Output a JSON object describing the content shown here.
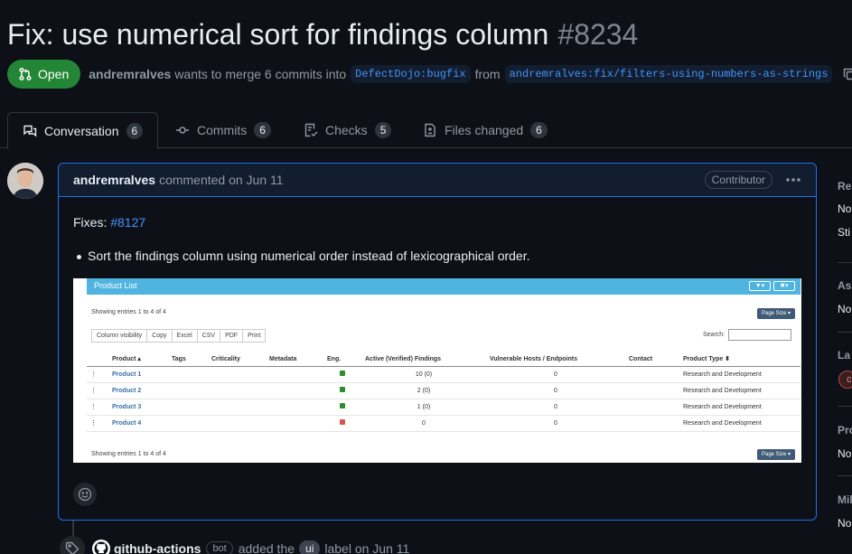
{
  "pr": {
    "title": "Fix: use numerical sort for findings column",
    "number": "#8234",
    "status": "Open",
    "author": "andremralves",
    "merge_text": "wants to merge 6 commits into",
    "base_branch": "DefectDojo:bugfix",
    "from_text": "from",
    "head_branch": "andremralves:fix/filters-using-numbers-as-strings"
  },
  "tabs": [
    {
      "label": "Conversation",
      "count": "6",
      "icon": "comment-discussion-icon"
    },
    {
      "label": "Commits",
      "count": "6",
      "icon": "git-commit-icon"
    },
    {
      "label": "Checks",
      "count": "5",
      "icon": "checklist-icon"
    },
    {
      "label": "Files changed",
      "count": "6",
      "icon": "file-diff-icon"
    }
  ],
  "comment": {
    "author": "andremralves",
    "meta": "commented on Jun 11",
    "role": "Contributor",
    "fixes_label": "Fixes:",
    "fixes_link": "#8127",
    "bullet": "Sort the findings column using numerical order instead of lexicographical order."
  },
  "embedded": {
    "header": "Product List",
    "showing_top": "Showing entries 1 to 4 of 4",
    "showing_bottom": "Showing entries 1 to 4 of 4",
    "page_size": "Page Size",
    "buttons": [
      "Column visibility",
      "Copy",
      "Excel",
      "CSV",
      "PDF",
      "Print"
    ],
    "search_label": "Search:",
    "columns": [
      "",
      "Product ▴",
      "Tags",
      "Criticality",
      "Metadata",
      "Eng.",
      "Active (Verified) Findings",
      "Vulnerable Hosts / Endpoints",
      "Contact",
      "Product Type ⬍"
    ],
    "rows": [
      {
        "name": "Product 1",
        "eng": "green",
        "findings": "10  (0)",
        "hosts": "0",
        "type": "Research and Development"
      },
      {
        "name": "Product 2",
        "eng": "green",
        "findings": "2  (0)",
        "hosts": "0",
        "type": "Research and Development"
      },
      {
        "name": "Product 3",
        "eng": "green",
        "findings": "1  (0)",
        "hosts": "0",
        "type": "Research and Development"
      },
      {
        "name": "Product 4",
        "eng": "red",
        "findings": "0",
        "hosts": "0",
        "type": "Research and Development"
      }
    ]
  },
  "event": {
    "actor": "github-actions",
    "bot": "bot",
    "action": "added the",
    "label": "ui",
    "suffix": "label on Jun 11"
  },
  "sidebar": {
    "reviewers_h": "Re",
    "reviewers_v1": "No",
    "reviewers_v2": "Sti",
    "assignees_h": "As",
    "assignees_v": "No",
    "labels_h": "La",
    "label_chip": "c",
    "projects_h": "Pro",
    "projects_v": "No",
    "milestone_h": "Mil",
    "milestone_v": "No"
  },
  "colors": {
    "background": "#0d1117",
    "open_green": "#238636",
    "link_blue": "#4493f8",
    "comment_border": "#1f6feb"
  }
}
